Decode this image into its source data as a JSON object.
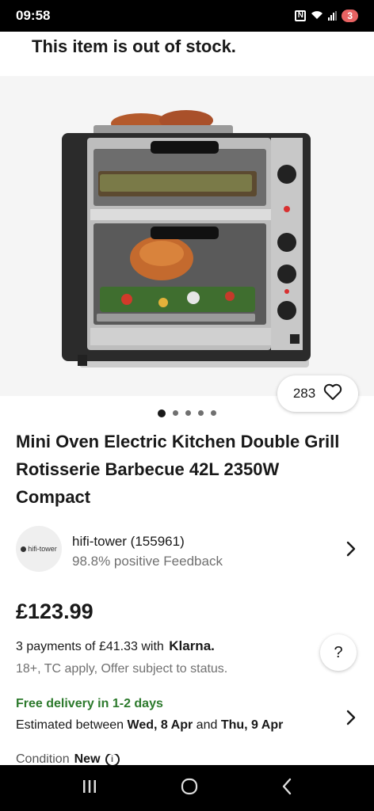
{
  "status_bar": {
    "time": "09:58",
    "battery": "3"
  },
  "banner": {
    "text": "This item is out of stock."
  },
  "gallery": {
    "watchers": "283",
    "image_count": 5,
    "current_index": 0
  },
  "product": {
    "title": "Mini Oven Electric Kitchen Double Grill Rotisserie Barbecue 42L 2350W Compact"
  },
  "seller": {
    "logo_text": "hifi-tower",
    "name": "hifi-tower (155961)",
    "feedback": "98.8% positive Feedback"
  },
  "price": "£123.99",
  "klarna": {
    "text": "3 payments of £41.33 with",
    "brand": "Klarna.",
    "note": "18+, TC apply, Offer subject to status."
  },
  "help": {
    "label": "?"
  },
  "delivery": {
    "headline": "Free delivery in 1-2 days",
    "estimate_prefix": "Estimated between",
    "date_from": "Wed, 8 Apr",
    "conjunction": "and",
    "date_to": "Thu, 9 Apr"
  },
  "condition": {
    "label": "Condition",
    "value": "New"
  },
  "colors": {
    "delivery_green": "#2d7a2d",
    "battery_red": "#e86262"
  }
}
